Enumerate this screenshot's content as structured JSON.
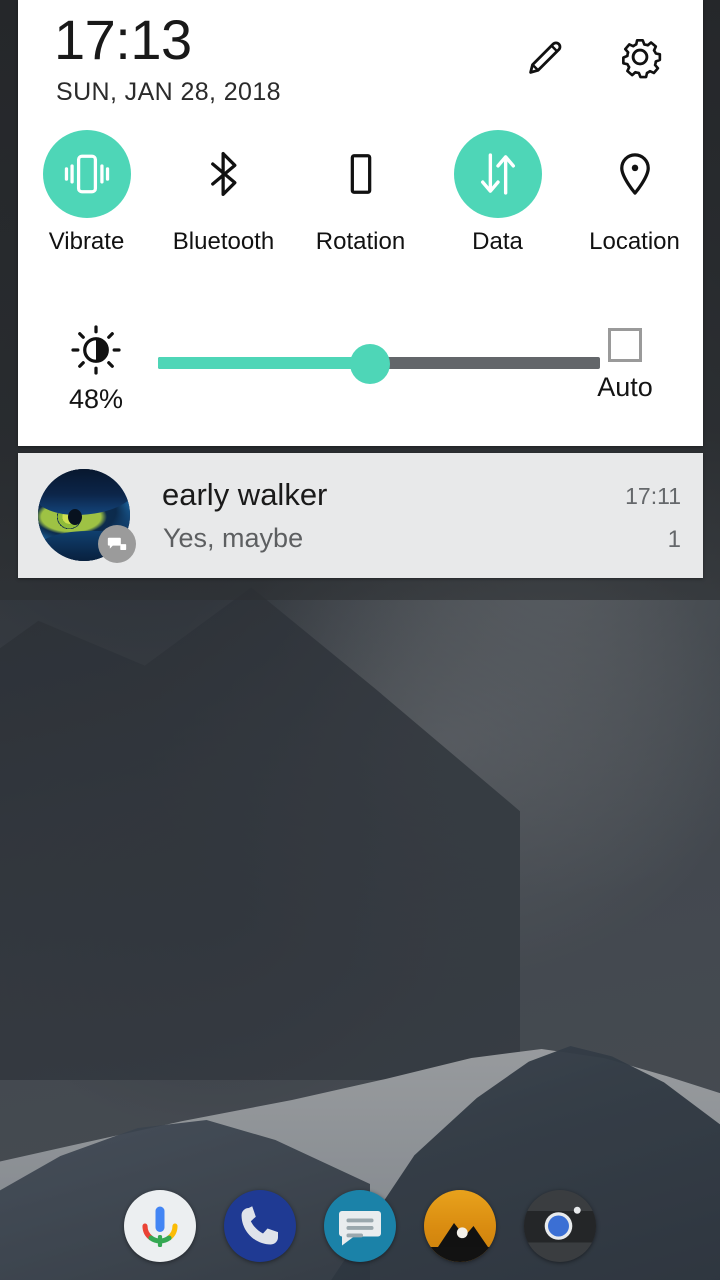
{
  "status": {
    "time": "17:13",
    "date": "SUN, JAN 28, 2018"
  },
  "header": {
    "edit_icon": "pencil-icon",
    "settings_icon": "gear-icon"
  },
  "theme": {
    "accent": "#4ed6b7",
    "panel_bg": "#ffffff",
    "notification_bg": "#e8e9ea",
    "track_inactive": "#63666a"
  },
  "tiles": [
    {
      "label": "Vibrate",
      "icon": "vibrate-icon",
      "active": true,
      "state": "on"
    },
    {
      "label": "Bluetooth",
      "icon": "bluetooth-icon",
      "active": false,
      "state": "off"
    },
    {
      "label": "Rotation",
      "icon": "rotation-icon",
      "active": false,
      "state": "off"
    },
    {
      "label": "Data",
      "icon": "data-icon",
      "active": true,
      "state": "on"
    },
    {
      "label": "Location",
      "icon": "location-icon",
      "active": false,
      "state": "off"
    }
  ],
  "brightness": {
    "icon": "brightness-icon",
    "percent_label": "48%",
    "value": 48,
    "auto_label": "Auto",
    "auto_checked": false
  },
  "notification": {
    "title": "early walker",
    "text": "Yes, maybe",
    "time": "17:11",
    "count": "1",
    "avatar": "avatar-blue-eye",
    "badge_icon": "message-badge-icon"
  },
  "dock": [
    {
      "name": "google-voice-search",
      "icon": "microphone-icon"
    },
    {
      "name": "phone",
      "icon": "phone-handset-icon"
    },
    {
      "name": "messages",
      "icon": "message-bubble-icon"
    },
    {
      "name": "photos",
      "icon": "mountain-sunset-icon"
    },
    {
      "name": "camera",
      "icon": "camera-lens-icon"
    }
  ]
}
